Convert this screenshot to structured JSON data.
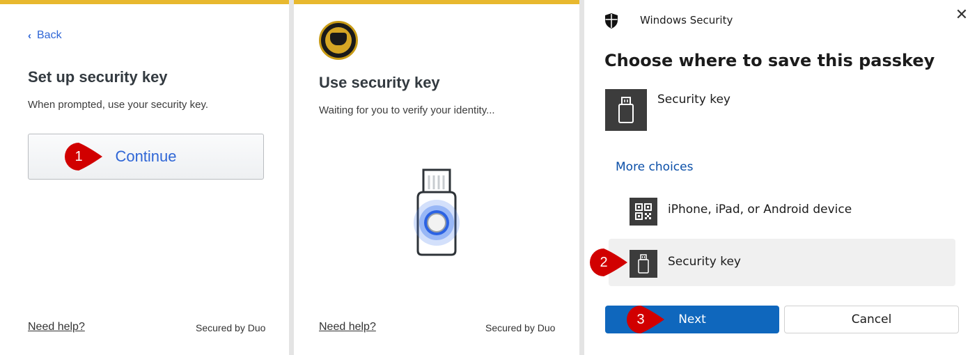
{
  "duo_setup": {
    "back_label": "Back",
    "title": "Set up security key",
    "subtitle": "When prompted, use your security key.",
    "continue_label": "Continue",
    "help_label": "Need help?",
    "secured_label": "Secured by Duo"
  },
  "duo_use": {
    "title": "Use security key",
    "subtitle": "Waiting for you to verify your identity...",
    "help_label": "Need help?",
    "secured_label": "Secured by Duo"
  },
  "windows_security": {
    "app_title": "Windows Security",
    "heading": "Choose where to save this passkey",
    "primary_option": "Security key",
    "more_choices": "More choices",
    "options": [
      {
        "label": "iPhone, iPad, or Android device",
        "icon": "qr-code-icon"
      },
      {
        "label": "Security key",
        "icon": "usb-key-icon"
      }
    ],
    "next_label": "Next",
    "cancel_label": "Cancel"
  },
  "callouts": [
    "1",
    "2",
    "3"
  ],
  "colors": {
    "duo_accent": "#e8b82e",
    "duo_link": "#2f66d6",
    "callout_red": "#d10000",
    "windows_primary": "#0f67bd"
  }
}
